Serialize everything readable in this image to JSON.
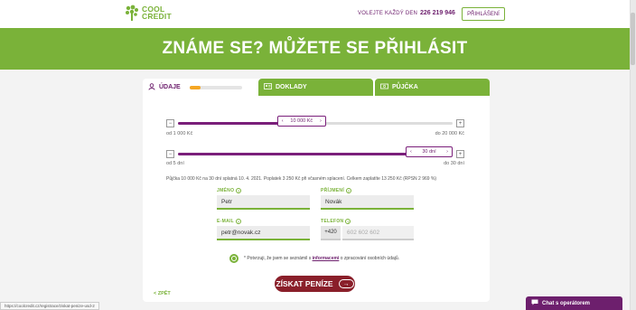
{
  "header": {
    "logo_line1": "COOL",
    "logo_line2": "CREDIT",
    "call_label": "VOLEJTE KAŽDÝ DEN",
    "phone": "226 219 946",
    "login_label": "PŘIHLÁŠENÍ"
  },
  "hero": {
    "title": "ZNÁME SE? MŮŽETE SE PŘIHLÁSIT"
  },
  "tabs": [
    {
      "label": "ÚDAJE",
      "icon": "user-icon",
      "progress": 0.22
    },
    {
      "label": "DOKLADY",
      "icon": "id-card-icon"
    },
    {
      "label": "PŮJČKA",
      "icon": "money-icon"
    }
  ],
  "amount_slider": {
    "value_label": "10 000 Kč",
    "min_label": "od 1 000 Kč",
    "max_label": "do 20 000 Kč",
    "fraction": 0.45
  },
  "days_slider": {
    "value_label": "30 dní",
    "min_label": "od 5 dní",
    "max_label": "do 30 dní",
    "fraction": 1.0
  },
  "summary": "Půjčka 10 000 Kč na 30 dní splatná 10. 4. 2021. Poplatek 3 250 Kč při včasném splacení. Celkem zaplatíte 13 250 Kč (RPSN 2 969 %)",
  "form": {
    "first_name_label": "JMÉNO",
    "first_name_value": "Petr",
    "last_name_label": "PŘÍJMENÍ",
    "last_name_value": "Novák",
    "email_label": "E-MAIL",
    "email_value": "petr@novak.cz",
    "phone_label": "TELEFON",
    "phone_prefix": "+420",
    "phone_placeholder": "602 602 602"
  },
  "consent": {
    "before": "* Potvrzuji, že jsem se seznámil s",
    "link": "informacemi",
    "after": "o zpracování osobních údajů."
  },
  "submit_label": "ZÍSKAT PENÍZE",
  "back_label": "< ZPĚT",
  "status_url": "https://coolcredit.cz/registrace/ziskat-penize-usd-2",
  "chat_label": "Chat s operátorem",
  "colors": {
    "green": "#7ab239",
    "purple": "#6d1f6d",
    "submit": "#8a1f2a"
  }
}
